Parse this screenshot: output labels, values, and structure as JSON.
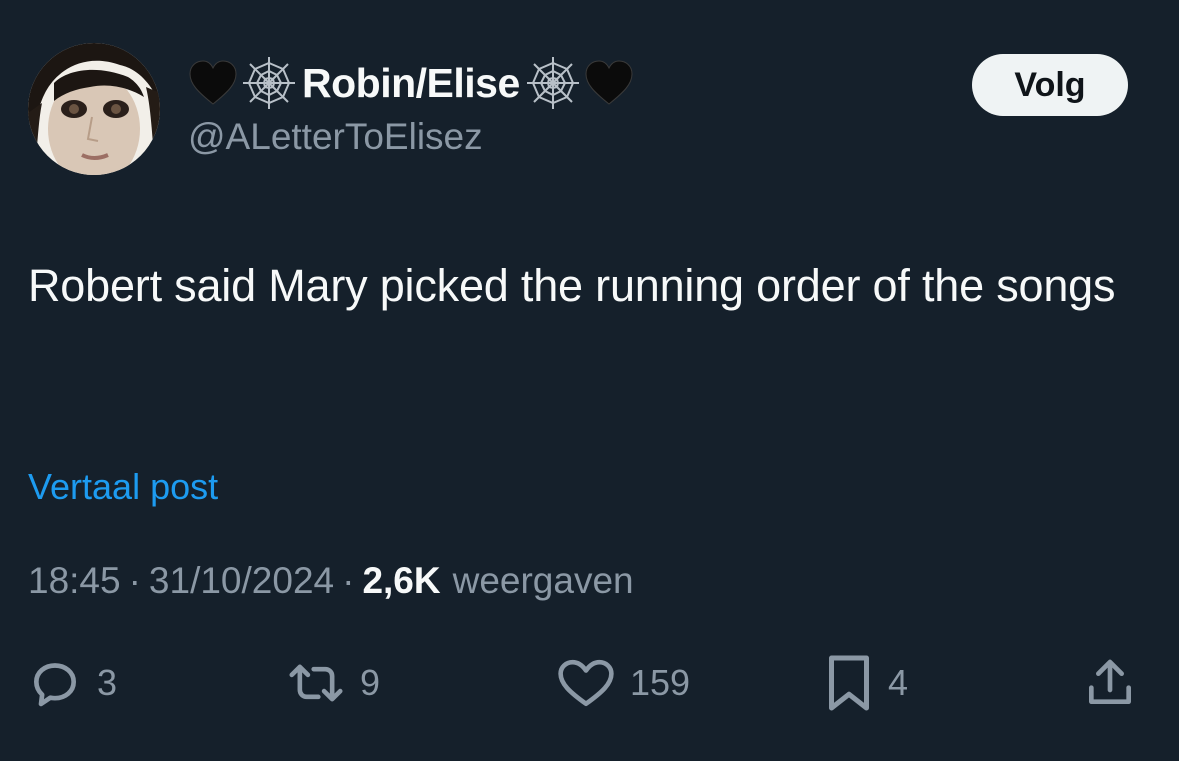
{
  "author": {
    "display_name": "Robin/Elise",
    "handle": "@ALetterToElisez",
    "name_emojis": [
      "black-heart",
      "spider-web",
      "spider-web",
      "black-heart"
    ]
  },
  "follow_button": {
    "label": "Volg"
  },
  "tweet": {
    "text": "Robert said Mary picked the running order of the songs",
    "translate_label": "Vertaal post"
  },
  "meta": {
    "time": "18:45",
    "separator": "·",
    "date": "31/10/2024",
    "views_count": "2,6K",
    "views_label": "weergaven"
  },
  "actions": {
    "replies": "3",
    "reposts": "9",
    "likes": "159",
    "bookmarks": "4"
  },
  "colors": {
    "background": "#15202b",
    "text_primary": "#f7f9f9",
    "text_secondary": "#8b98a5",
    "link": "#1d9bf0",
    "follow_bg": "#eff3f4"
  }
}
